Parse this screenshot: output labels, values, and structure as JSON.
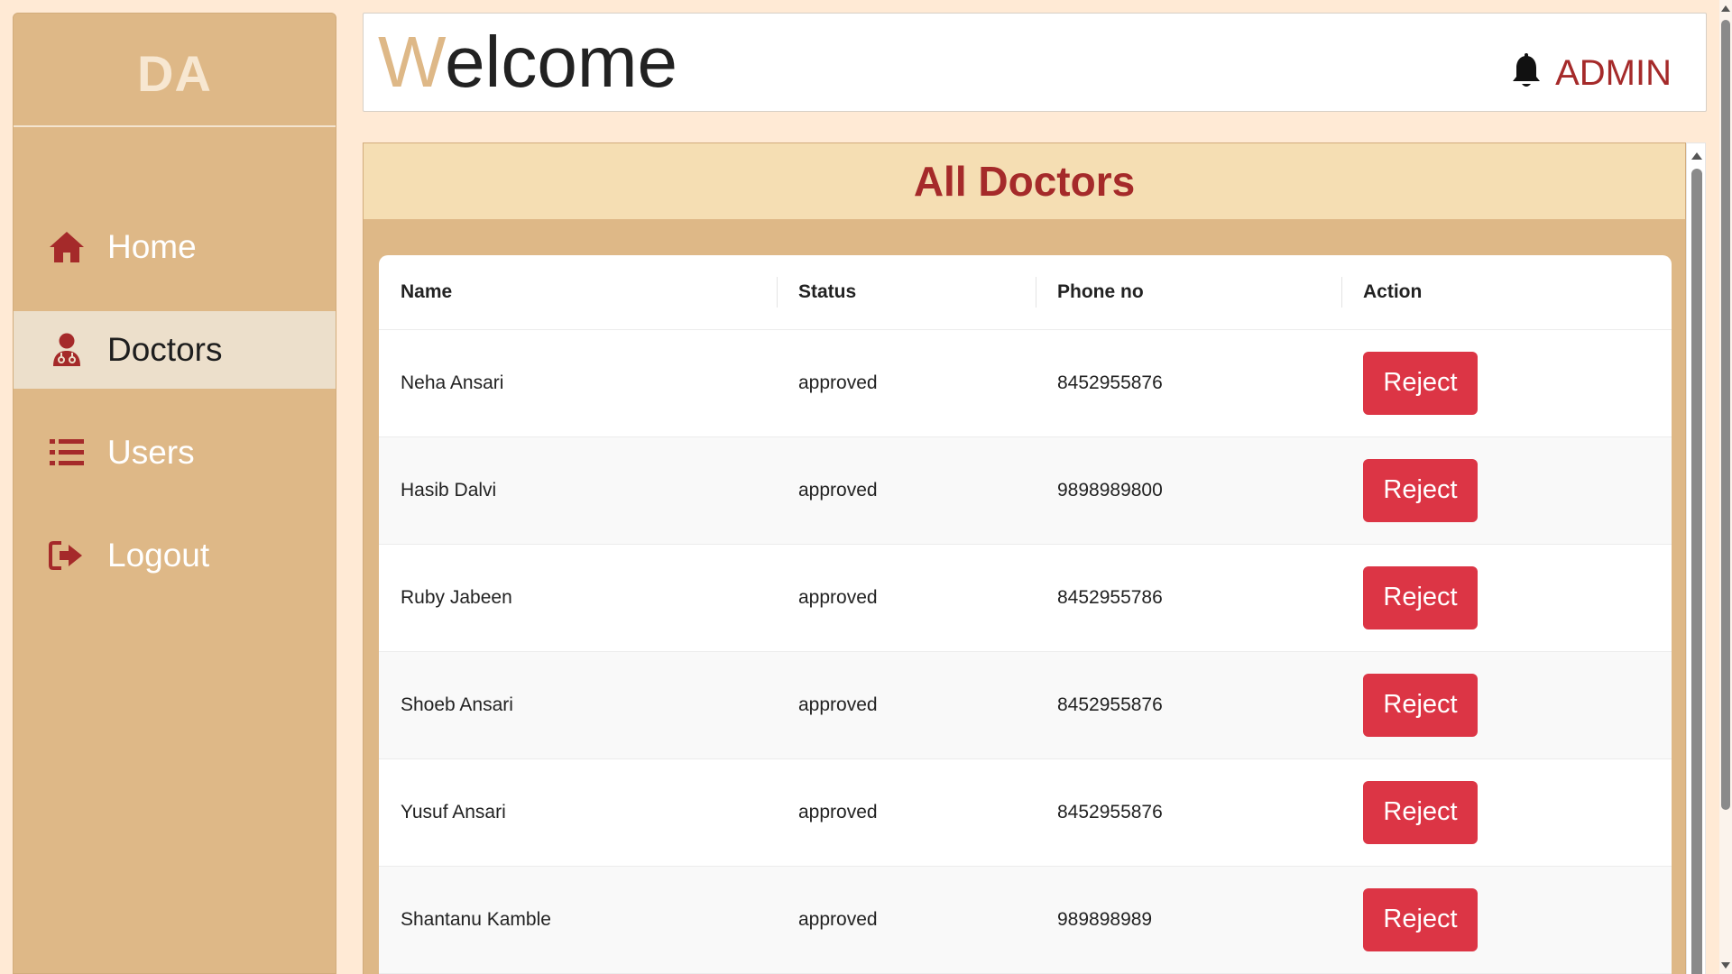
{
  "brand": {
    "logo": "DA"
  },
  "sidebar": {
    "items": [
      {
        "label": "Home",
        "icon": "home-icon",
        "active": false
      },
      {
        "label": "Doctors",
        "icon": "doctor-icon",
        "active": true
      },
      {
        "label": "Users",
        "icon": "list-icon",
        "active": false
      },
      {
        "label": "Logout",
        "icon": "logout-icon",
        "active": false
      }
    ]
  },
  "header": {
    "welcome_first": "W",
    "welcome_rest": "elcome",
    "user": "ADMIN",
    "notification_icon": "bell-icon"
  },
  "panel": {
    "title": "All Doctors"
  },
  "table": {
    "columns": [
      "Name",
      "Status",
      "Phone no",
      "Action"
    ],
    "rows": [
      {
        "name": "Neha Ansari",
        "status": "approved",
        "phone": "8452955876",
        "action": "Reject"
      },
      {
        "name": "Hasib Dalvi",
        "status": "approved",
        "phone": "9898989800",
        "action": "Reject"
      },
      {
        "name": "Ruby Jabeen",
        "status": "approved",
        "phone": "8452955786",
        "action": "Reject"
      },
      {
        "name": "Shoeb Ansari",
        "status": "approved",
        "phone": "8452955876",
        "action": "Reject"
      },
      {
        "name": "Yusuf Ansari",
        "status": "approved",
        "phone": "8452955876",
        "action": "Reject"
      },
      {
        "name": "Shantanu Kamble",
        "status": "approved",
        "phone": "989898989",
        "action": "Reject"
      }
    ]
  },
  "colors": {
    "sidebar_bg": "#deb887",
    "page_bg": "#ffead5",
    "accent_red": "#a52a2a",
    "panel_head_bg": "#f5deb3",
    "reject_button": "#dc3545"
  }
}
